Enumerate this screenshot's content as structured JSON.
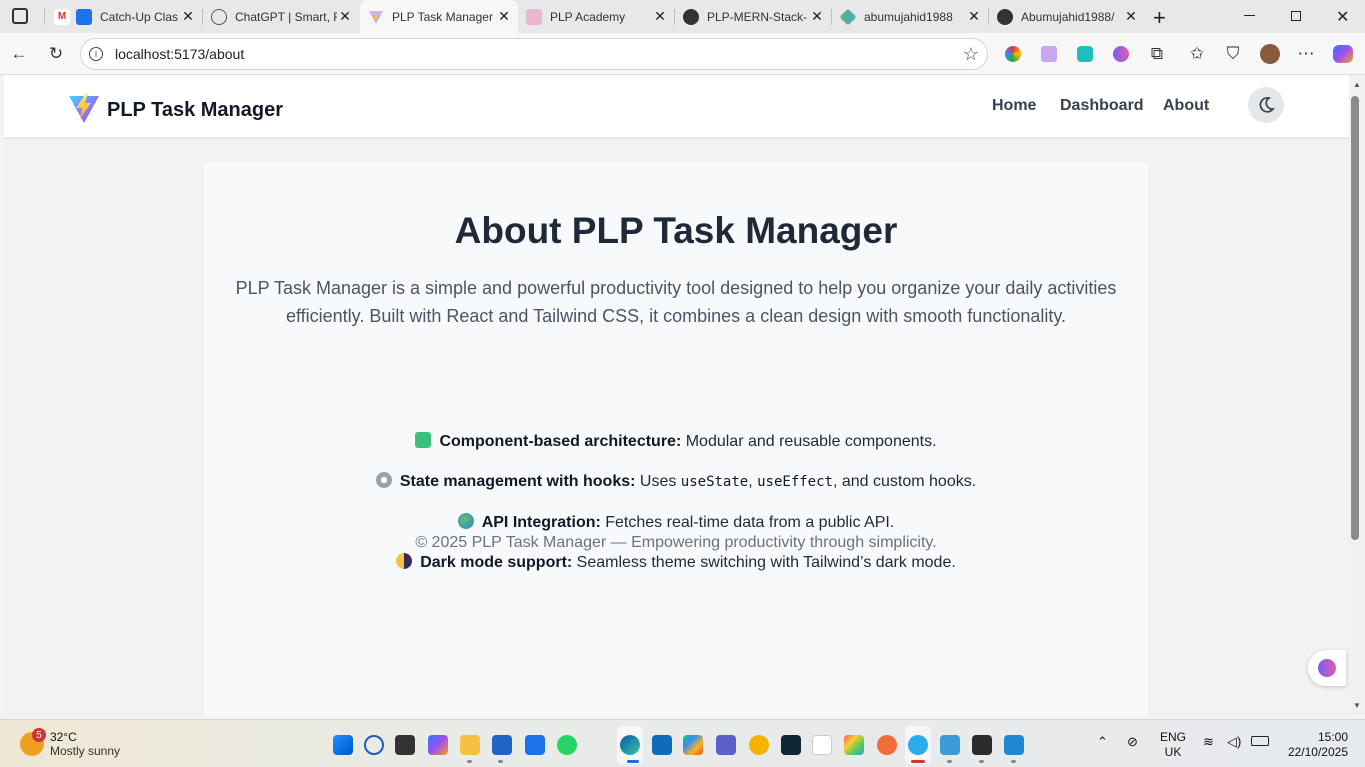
{
  "browser": {
    "tabs": [
      {
        "title": "Catch-Up Clas",
        "active": false
      },
      {
        "title": "ChatGPT | Smart, F",
        "active": false
      },
      {
        "title": "PLP Task Manager",
        "active": true
      },
      {
        "title": "PLP Academy",
        "active": false
      },
      {
        "title": "PLP-MERN-Stack-",
        "active": false
      },
      {
        "title": "abumujahid1988",
        "active": false
      },
      {
        "title": "Abumujahid1988/",
        "active": false
      }
    ],
    "url": "localhost:5173/about"
  },
  "app": {
    "brand": "PLP Task Manager",
    "nav": {
      "home": "Home",
      "dashboard": "Dashboard",
      "about": "About"
    }
  },
  "about": {
    "title": "About PLP Task Manager",
    "intro": "PLP Task Manager is a simple and powerful productivity tool designed to help you organize your daily activities efficiently. Built with React and Tailwind CSS, it combines a clean design with smooth functionality.",
    "features": [
      {
        "icon": "sparkle-icon",
        "label": "Component-based architecture:",
        "text": " Modular and reusable components."
      },
      {
        "icon": "gear-icon",
        "label": "State management with hooks:",
        "text_before": " Uses ",
        "code1": "useState",
        "sep": ", ",
        "code2": "useEffect",
        "text_after": ", and custom hooks."
      },
      {
        "icon": "globe-icon",
        "label": "API Integration:",
        "text": " Fetches real-time data from a public API."
      },
      {
        "icon": "half-moon-icon",
        "label": "Dark mode support:",
        "text": " Seamless theme switching with Tailwind’s dark mode."
      }
    ],
    "footer": "© 2025 PLP Task Manager — Empowering productivity through simplicity."
  },
  "taskbar": {
    "weather_temp": "32°C",
    "weather_desc": "Mostly sunny",
    "weather_badge": "5",
    "lang1": "ENG",
    "lang2": "UK",
    "time": "15:00",
    "date": "22/10/2025"
  },
  "colors": {
    "accent": "#1f2937",
    "page_bg": "#f1f2f4",
    "card_bg": "#f8f9fb"
  }
}
